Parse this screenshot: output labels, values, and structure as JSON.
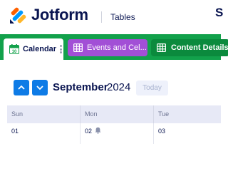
{
  "header": {
    "brand": "Jotform",
    "product": "Tables",
    "user_initial": "S",
    "logo_icon": "jotform-logo-icon",
    "brand_color": "#0a1551"
  },
  "tabs": [
    {
      "label": "Calendar",
      "icon": "calendar-icon",
      "active": true,
      "color": "#ffffff"
    },
    {
      "label": "Events and Cel...",
      "icon": "table-grid-icon",
      "active": false,
      "color": "#a24fd6"
    },
    {
      "label": "Content Details",
      "icon": "table-grid-icon",
      "active": false,
      "color": "#0b8a3d"
    }
  ],
  "calendar": {
    "month": "September",
    "year": "2024",
    "today_label": "Today",
    "calendar_icon_day": "10",
    "weekdays": [
      "Sun",
      "Mon",
      "Tue"
    ],
    "days": [
      {
        "num": "01",
        "has_reminder": false
      },
      {
        "num": "02",
        "has_reminder": true
      },
      {
        "num": "03",
        "has_reminder": false
      }
    ]
  },
  "colors": {
    "tabbar": "#12a14b",
    "nav_button": "#0e7be6",
    "weekday_header": "#e7e9f6"
  }
}
